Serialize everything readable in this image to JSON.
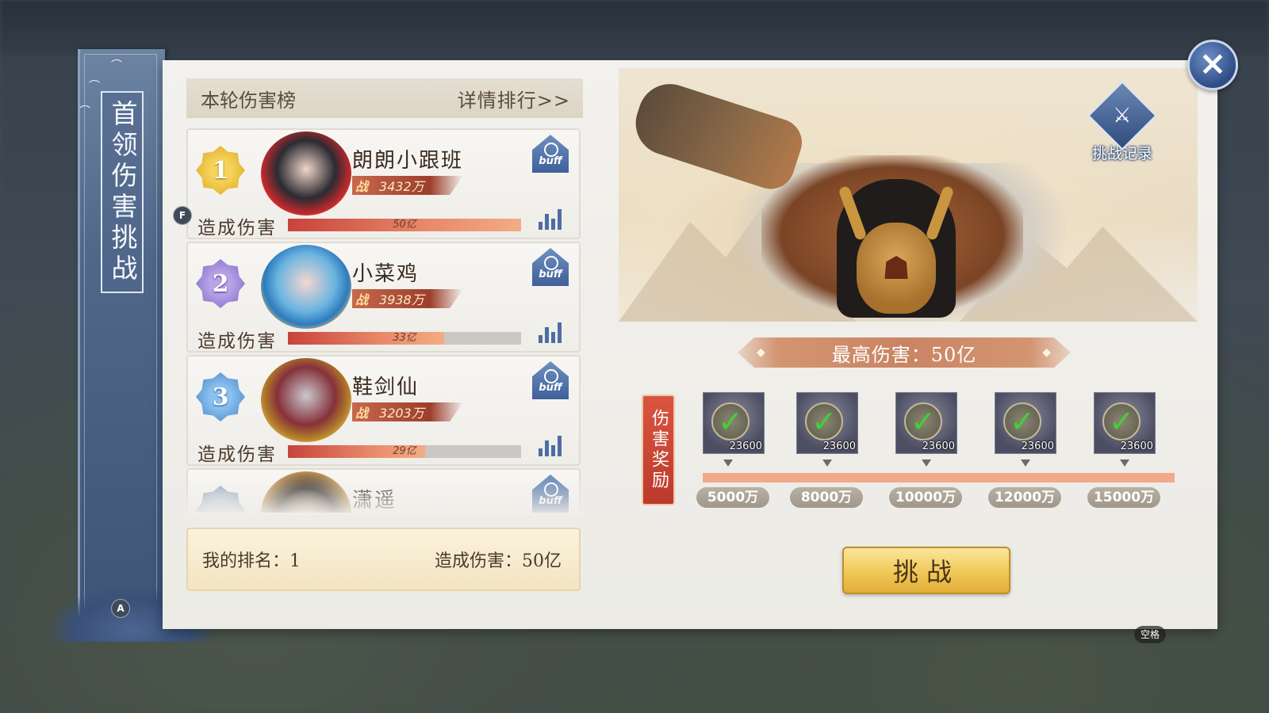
{
  "spine_title": "首领伤害挑战",
  "leaderboard": {
    "title": "本轮伤害榜",
    "detail_link": "详情排行>>",
    "damage_label": "造成伤害",
    "buff_label": "buff",
    "power_prefix": "战",
    "entries": [
      {
        "rank": "1",
        "name": "朗朗小跟班",
        "power": "3432万",
        "damage": "50亿",
        "damage_fraction": 1.0
      },
      {
        "rank": "2",
        "name": "小菜鸡",
        "power": "3938万",
        "damage": "33亿",
        "damage_fraction": 0.67
      },
      {
        "rank": "3",
        "name": "鞋剑仙",
        "power": "3203万",
        "damage": "29亿",
        "damage_fraction": 0.59
      },
      {
        "rank": "",
        "name": "潇遥",
        "power": "",
        "damage": "",
        "damage_fraction": 0.0
      }
    ]
  },
  "my_rank": {
    "rank_text": "我的排名：1",
    "damage_text": "造成伤害：50亿"
  },
  "battle_record_label": "挑战记录",
  "max_damage": "最高伤害：50亿",
  "reward_label": "伤害奖励",
  "rewards": [
    {
      "quantity": "23600",
      "threshold": "5000万",
      "claimed": true
    },
    {
      "quantity": "23600",
      "threshold": "8000万",
      "claimed": true
    },
    {
      "quantity": "23600",
      "threshold": "10000万",
      "claimed": true
    },
    {
      "quantity": "23600",
      "threshold": "12000万",
      "claimed": true
    },
    {
      "quantity": "23600",
      "threshold": "15000万",
      "claimed": true
    }
  ],
  "challenge_button": "挑战",
  "close_icon": "close-icon",
  "key_hints": {
    "f": "F",
    "a": "A",
    "space": "空格"
  },
  "colors": {
    "panel_bg": "#f3f1ed",
    "spine": "#50678a",
    "accent_red": "#c8433b",
    "gold": "#f0c857"
  }
}
